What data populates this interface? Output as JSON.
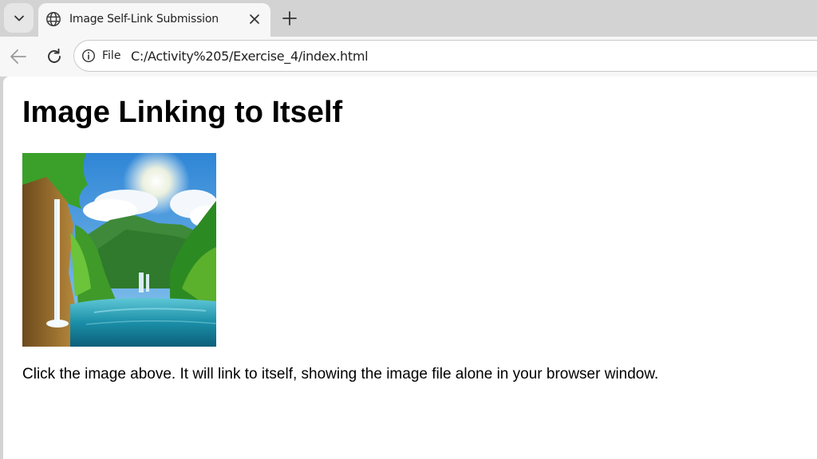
{
  "browser": {
    "tab": {
      "title": "Image Self-Link Submission"
    },
    "address_bar": {
      "scheme_label": "File",
      "url": "C:/Activity%205/Exercise_4/index.html"
    },
    "icons": [
      "tab-list-icon",
      "globe-icon",
      "close-icon",
      "plus-icon",
      "back-arrow-icon",
      "reload-icon",
      "info-icon"
    ]
  },
  "page": {
    "heading": "Image Linking to Itself",
    "image": {
      "depicts": "waterfall-lake-landscape-image",
      "links_to": "self"
    },
    "caption": "Click the image above. It will link to itself, showing the image file alone in your browser window."
  },
  "colors": {
    "chrome_bg": "#d3d3d3",
    "toolbar_bg": "#f7f7f7",
    "page_bg": "#ffffff",
    "text": "#000000"
  }
}
